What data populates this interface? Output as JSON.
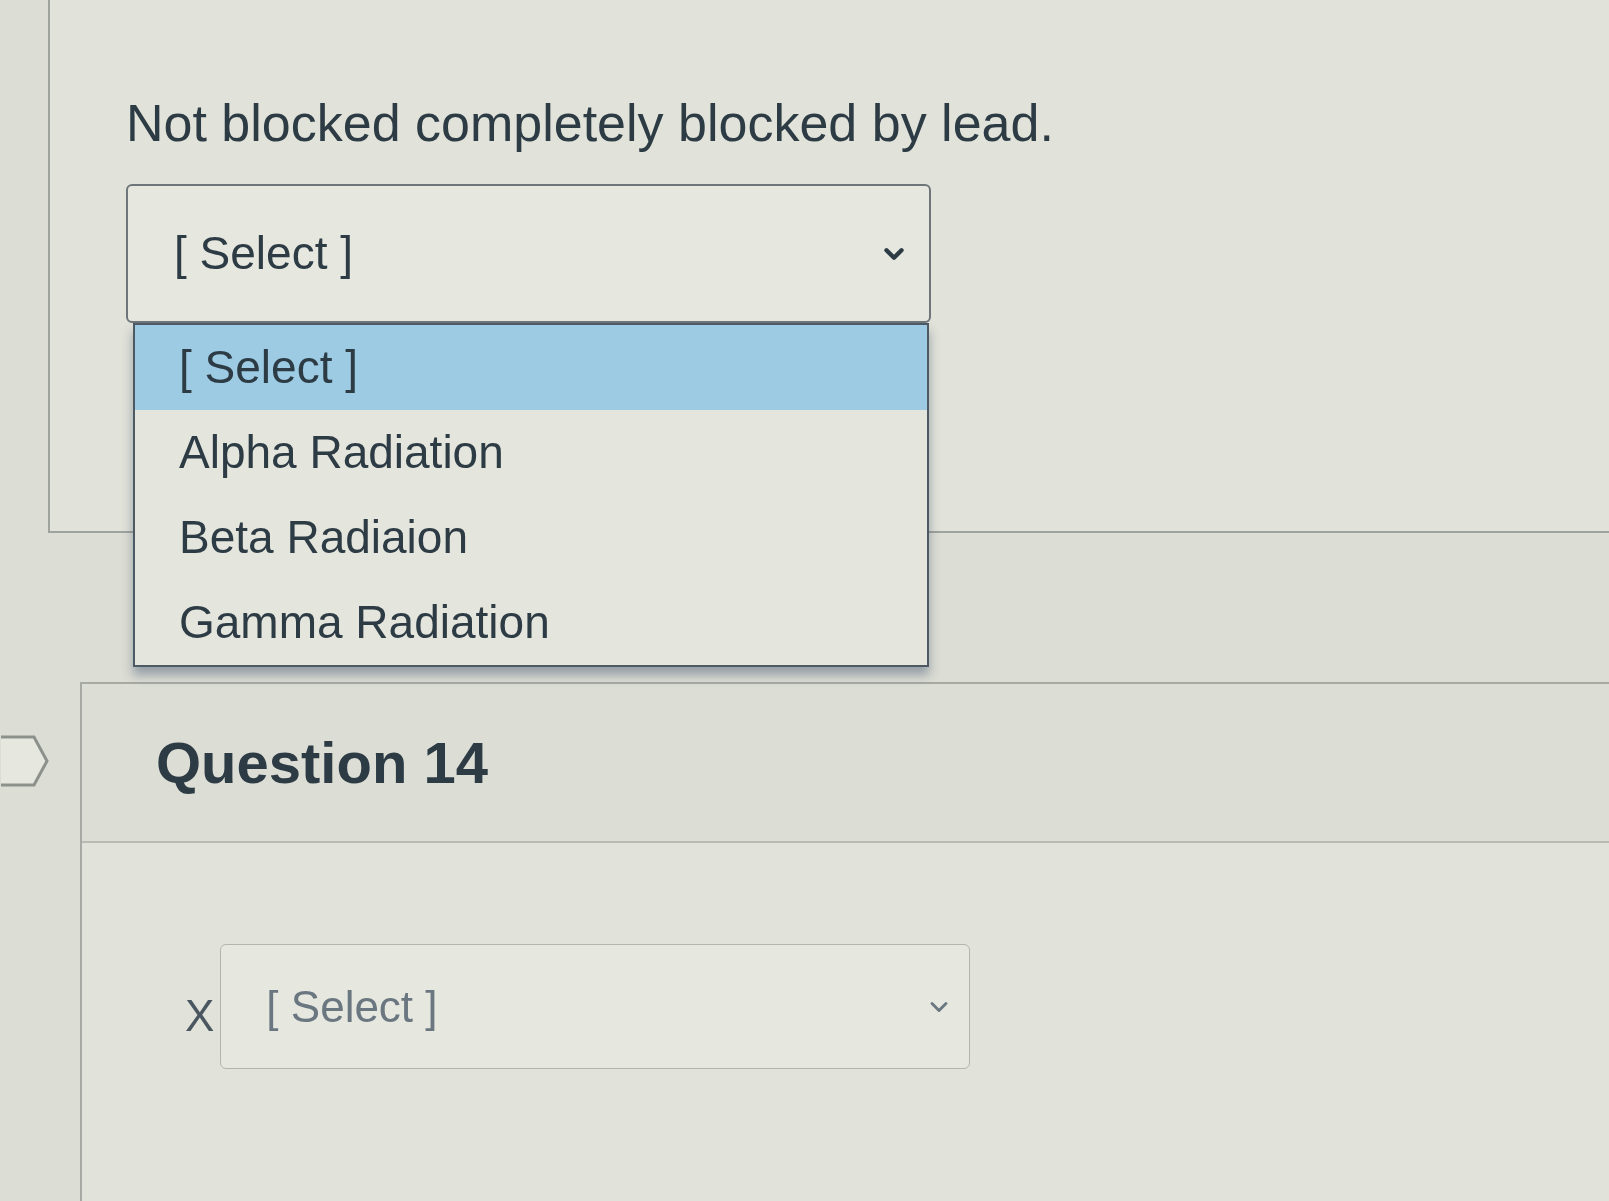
{
  "previous_question": {
    "text": "Not blocked completely blocked by lead.",
    "answer_select": {
      "value": "[ Select ]",
      "expanded": true,
      "options": [
        {
          "label": "[ Select ]",
          "selected": true
        },
        {
          "label": "Alpha Radiation",
          "selected": false
        },
        {
          "label": "Beta Radiaion",
          "selected": false
        },
        {
          "label": "Gamma Radiation",
          "selected": false
        }
      ]
    }
  },
  "question": {
    "title": "Question 14",
    "answer": {
      "prompt": "X",
      "select": {
        "value": "[ Select ]",
        "expanded": false
      }
    }
  }
}
